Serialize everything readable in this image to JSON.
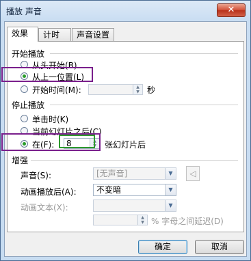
{
  "window": {
    "title": "播放 声音",
    "close_glyph": "✕"
  },
  "tabs": [
    {
      "label": "效果",
      "active": true
    },
    {
      "label": "计时",
      "active": false
    },
    {
      "label": "声音设置",
      "active": false
    }
  ],
  "start": {
    "title": "开始播放",
    "from_beginning": "从头开始(B)",
    "from_last_position": "从上一位置(L)",
    "from_time": "开始时间(M):",
    "seconds_unit": "秒"
  },
  "stop": {
    "title": "停止播放",
    "on_click": "单击时(K)",
    "after_current_slide": "当前幻灯片之后(C)",
    "after": "在(F):",
    "after_value": "8",
    "after_unit": "张幻灯片后"
  },
  "enhancements": {
    "title": "增强",
    "sound_label": "声音(S):",
    "sound_value": "[无声音]",
    "after_animation_label": "动画播放后(A):",
    "after_animation_value": "不变暗",
    "animate_text_label": "动画文本(X):",
    "delay_label": "% 字母之间延迟(D)"
  },
  "buttons": {
    "ok": "确定",
    "cancel": "取消"
  },
  "colors": {
    "highlight_purple": "#7a1f8c",
    "highlight_green": "#2f9a2f",
    "radio_dot": "#2a9d2a"
  },
  "icons": {
    "speaker": "speaker-icon",
    "close": "close-icon"
  }
}
